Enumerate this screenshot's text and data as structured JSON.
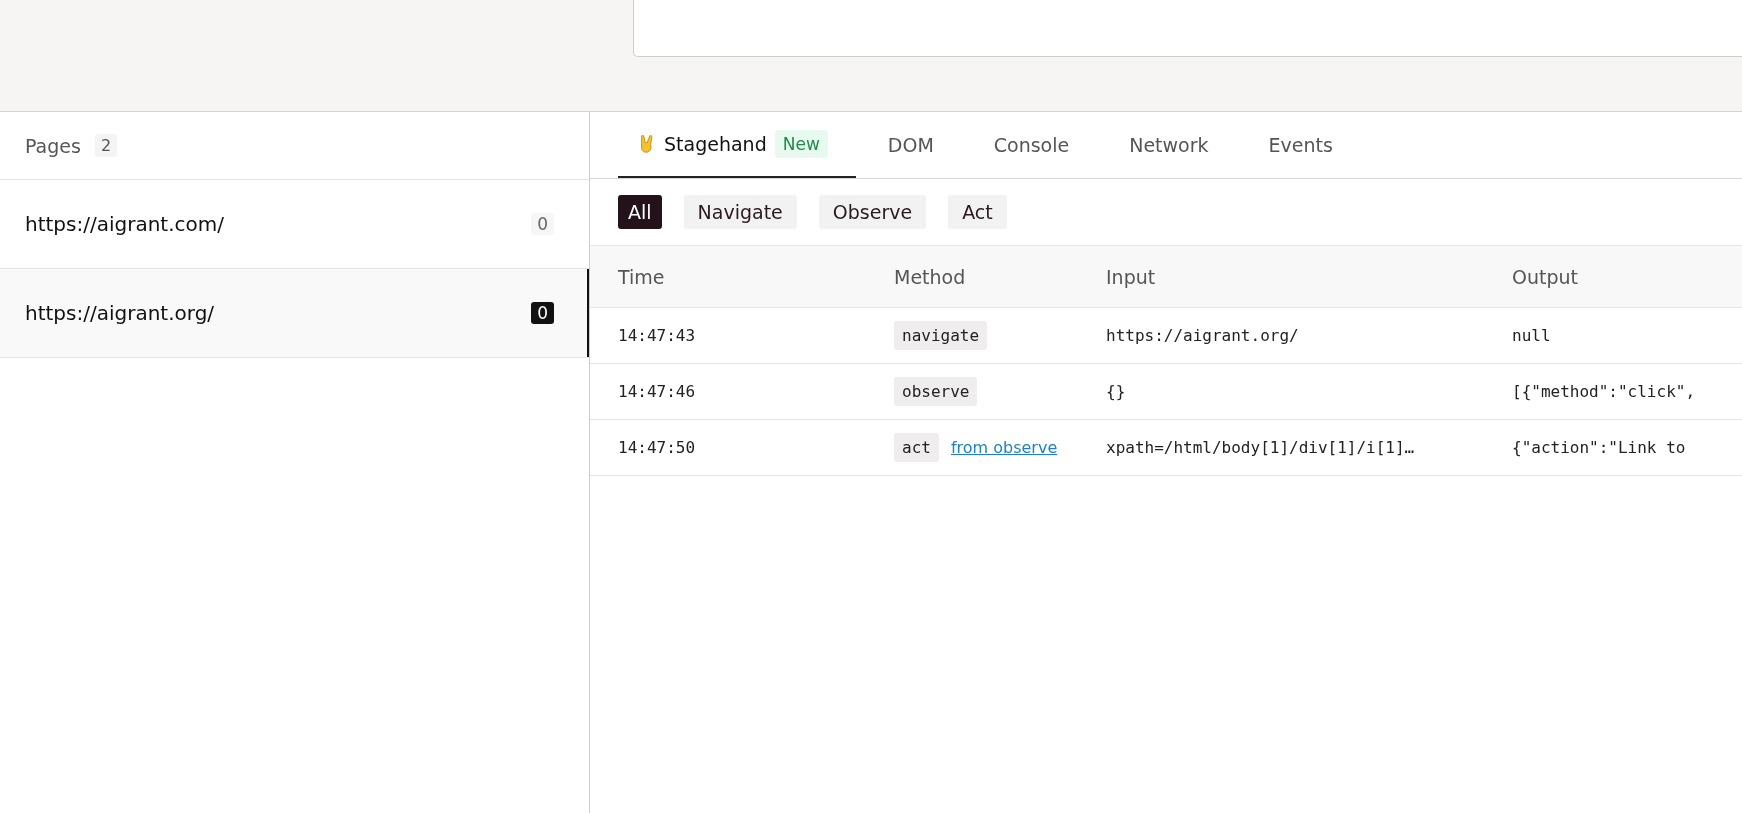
{
  "pages": {
    "label": "Pages",
    "count": "2",
    "items": [
      {
        "url": "https://aigrant.com/",
        "count": "0",
        "selected": false
      },
      {
        "url": "https://aigrant.org/",
        "count": "0",
        "selected": true
      }
    ]
  },
  "tabs": [
    {
      "label": "Stagehand",
      "badge": "New",
      "selected": true
    },
    {
      "label": "DOM",
      "selected": false
    },
    {
      "label": "Console",
      "selected": false
    },
    {
      "label": "Network",
      "selected": false
    },
    {
      "label": "Events",
      "selected": false
    }
  ],
  "filters": [
    {
      "label": "All",
      "selected": true
    },
    {
      "label": "Navigate",
      "selected": false
    },
    {
      "label": "Observe",
      "selected": false
    },
    {
      "label": "Act",
      "selected": false
    }
  ],
  "table": {
    "columns": [
      "Time",
      "Method",
      "Input",
      "Output"
    ],
    "rows": [
      {
        "time": "14:47:43",
        "method": "navigate",
        "input": "https://aigrant.org/",
        "output": "null"
      },
      {
        "time": "14:47:46",
        "method": "observe",
        "input": "{}",
        "output": "[{\"method\":\"click\","
      },
      {
        "time": "14:47:50",
        "method": "act",
        "link": "from observe",
        "input": "xpath=/html/body[1]/div[1]/i[1]…",
        "output": "{\"action\":\"Link to"
      }
    ]
  }
}
